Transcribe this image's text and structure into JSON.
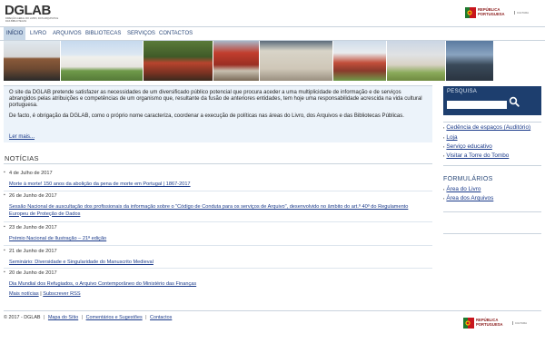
{
  "header": {
    "logo": "DGLAB",
    "logo_sub": "Direção-Geral do Livro, dos Arquivos e das Bibliotecas",
    "rep_line1": "REPÚBLICA",
    "rep_line2": "PORTUGUESA",
    "rep_gov": "CULTURA"
  },
  "nav": [
    "INÍCIO",
    "LIVRO",
    "ARQUIVOS",
    "BIBLIOTECAS",
    "SERVIÇOS",
    "CONTACTOS"
  ],
  "intro": {
    "p1": "O site da DGLAB pretende satisfazer as necessidades de um diversificado público potencial que procura aceder a uma multiplicidade de informação e de serviços abrangidos pelas atribuições e competências de um organismo que, resultante da fusão de anteriores entidades, tem hoje uma responsabilidade acrescida na vida cultural portuguesa.",
    "p2": "De facto, é obrigação da DGLAB, como o próprio nome caracteriza, coordenar a execução de políticas nas áreas do Livro, dos Arquivos e das Bibliotecas Públicas.",
    "more": "Ler mais..."
  },
  "news": {
    "title": "NOTÍCIAS",
    "items": [
      {
        "date": "4 de Julho de 2017",
        "title": "Morte à morte! 150 anos da abolição da pena de morte em Portugal | 1867-2017"
      },
      {
        "date": "26 de Junho de 2017",
        "title": "Sessão Nacional de auscultação dos profissionais da informação sobre o \"Código de Conduta para os serviços de Arquivo\", desenvolvido no âmbito do art.º 40º do Regulamento Europeu de Proteção de Dados"
      },
      {
        "date": "23 de Junho de 2017",
        "title": "Prémio Nacional de Ilustração – 21ª edição"
      },
      {
        "date": "21 de Junho de 2017",
        "title": "Seminário: Diversidade e Singularidade do Manuscrito Medieval"
      },
      {
        "date": "20 de Junho de 2017",
        "title": "Dia Mundial dos Refugiados, o Arquivo Contemporâneo do Ministério das Finanças"
      }
    ],
    "more": "Mais notícias",
    "rss": "Subscrever RSS"
  },
  "sidebar": {
    "search_label": "PESQUISA",
    "search_placeholder": "",
    "links": [
      "Cedência de espaços (Auditório)",
      "Loja",
      "Serviço educativo",
      "Visitar a Torre do Tombo"
    ],
    "forms_title": "FORMULÁRIOS",
    "forms": [
      "Área do Livro",
      "Área dos Arquivos"
    ]
  },
  "footer": {
    "copyright": "© 2017 - DGLAB",
    "links": [
      "Mapa do Sítio",
      "Comentários e Sugestões",
      "Contactos"
    ]
  },
  "colors": {
    "nav_active": "#c7d7e7",
    "search_bg": "#1d3e6e",
    "intro_bg": "#ecf3fa",
    "link": "#1a3a8a"
  }
}
